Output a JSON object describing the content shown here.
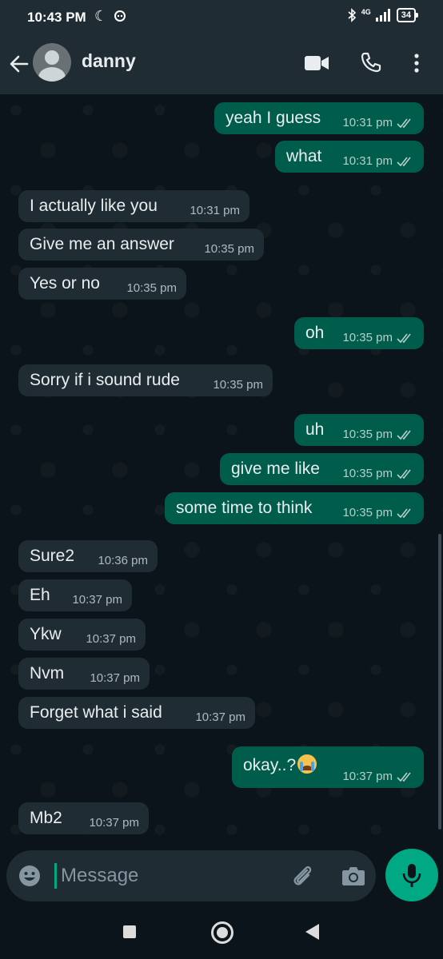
{
  "status_bar": {
    "time": "10:43 PM",
    "network": "4G",
    "battery": "34"
  },
  "header": {
    "contact_name": "danny"
  },
  "messages": [
    {
      "dir": "out",
      "text": "yeah I guess",
      "time": "10:31 pm",
      "read": true
    },
    {
      "dir": "out",
      "text": "what",
      "time": "10:31 pm",
      "read": true
    },
    {
      "dir": "in",
      "text": "I actually like you",
      "time": "10:31 pm"
    },
    {
      "dir": "in",
      "text": "Give me an answer",
      "time": "10:35 pm"
    },
    {
      "dir": "in",
      "text": "Yes or no",
      "time": "10:35 pm"
    },
    {
      "dir": "out",
      "text": "oh",
      "time": "10:35 pm",
      "read": true
    },
    {
      "dir": "in",
      "text": "Sorry if i sound rude",
      "time": "10:35 pm"
    },
    {
      "dir": "out",
      "text": "uh",
      "time": "10:35 pm",
      "read": true
    },
    {
      "dir": "out",
      "text": "give me like",
      "time": "10:35 pm",
      "read": true
    },
    {
      "dir": "out",
      "text": "some time to think",
      "time": "10:35 pm",
      "read": true
    },
    {
      "dir": "in",
      "text": "Sure2",
      "time": "10:36 pm"
    },
    {
      "dir": "in",
      "text": "Eh",
      "time": "10:37 pm"
    },
    {
      "dir": "in",
      "text": "Ykw",
      "time": "10:37 pm"
    },
    {
      "dir": "in",
      "text": "Nvm",
      "time": "10:37 pm"
    },
    {
      "dir": "in",
      "text": "Forget what i said",
      "time": "10:37 pm"
    },
    {
      "dir": "out",
      "text": "okay..?",
      "emoji": "loudly-crying-face",
      "time": "10:37 pm",
      "read": true
    },
    {
      "dir": "in",
      "text": "Mb2",
      "time": "10:37 pm"
    }
  ],
  "composer": {
    "placeholder": "Message"
  },
  "icons": {
    "back": "arrow-left-icon",
    "video": "video-call-icon",
    "call": "phone-icon",
    "menu": "more-vert-icon",
    "emoji": "smiley-icon",
    "attach": "paperclip-icon",
    "camera": "camera-icon",
    "mic": "microphone-icon"
  },
  "colors": {
    "incoming_bubble": "#202c33",
    "outgoing_bubble": "#005c4b",
    "accent": "#00a884",
    "read_tick": "#b4d0c9"
  }
}
